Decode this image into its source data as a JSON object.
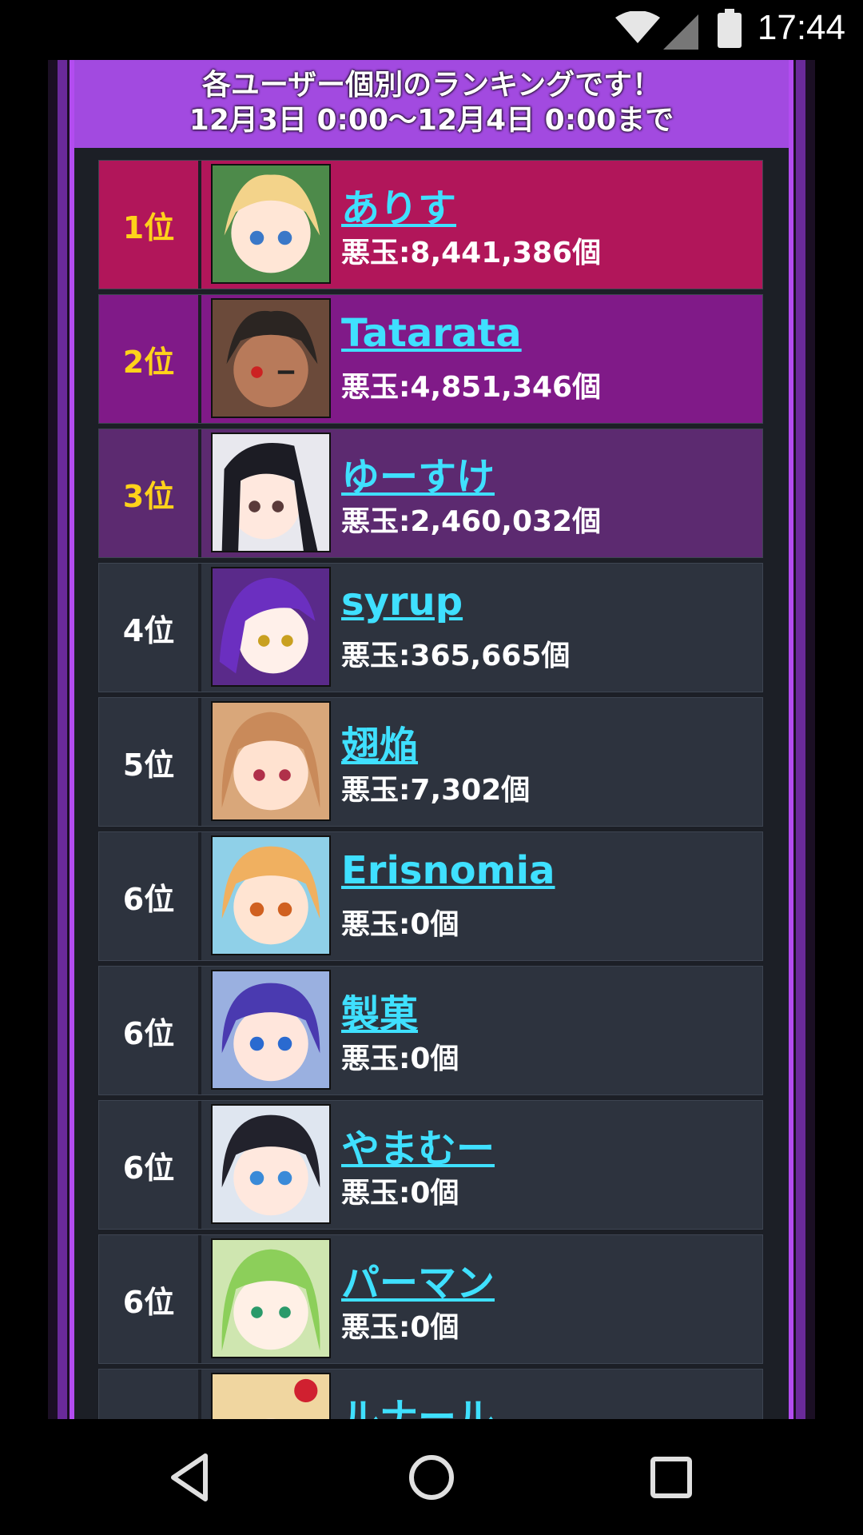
{
  "status_bar": {
    "time": "17:44"
  },
  "banner": {
    "line1": "各ユーザー個別のランキングです！",
    "line2": "12月3日 0:00〜12月4日 0:00まで"
  },
  "rows": [
    {
      "rank": "1位",
      "name": "ありす",
      "score": "悪玉:8,441,386個"
    },
    {
      "rank": "2位",
      "name": "Tatarata",
      "score": "悪玉:4,851,346個"
    },
    {
      "rank": "3位",
      "name": "ゆーすけ",
      "score": "悪玉:2,460,032個"
    },
    {
      "rank": "4位",
      "name": "syrup",
      "score": "悪玉:365,665個"
    },
    {
      "rank": "5位",
      "name": "翅焔",
      "score": "悪玉:7,302個"
    },
    {
      "rank": "6位",
      "name": "Erisnomia",
      "score": "悪玉:0個"
    },
    {
      "rank": "6位",
      "name": "製菓",
      "score": "悪玉:0個"
    },
    {
      "rank": "6位",
      "name": "やまむー",
      "score": "悪玉:0個"
    },
    {
      "rank": "6位",
      "name": "パーマン",
      "score": "悪玉:0個"
    },
    {
      "rank": "",
      "name": "ルナール",
      "score": ""
    }
  ],
  "colors": {
    "gold_row": "#b1165a",
    "silver_row": "#801a88",
    "bronze_row": "#5c2a70",
    "normal_row": "#2d333e",
    "name_link": "#3fe0ff",
    "top_rank_text": "#ffd21a",
    "banner": "#a24ae0"
  },
  "icons": {
    "status": [
      "wifi-icon",
      "cell-signal-icon",
      "battery-icon"
    ],
    "nav": [
      "back-icon",
      "home-icon",
      "recents-icon"
    ]
  }
}
